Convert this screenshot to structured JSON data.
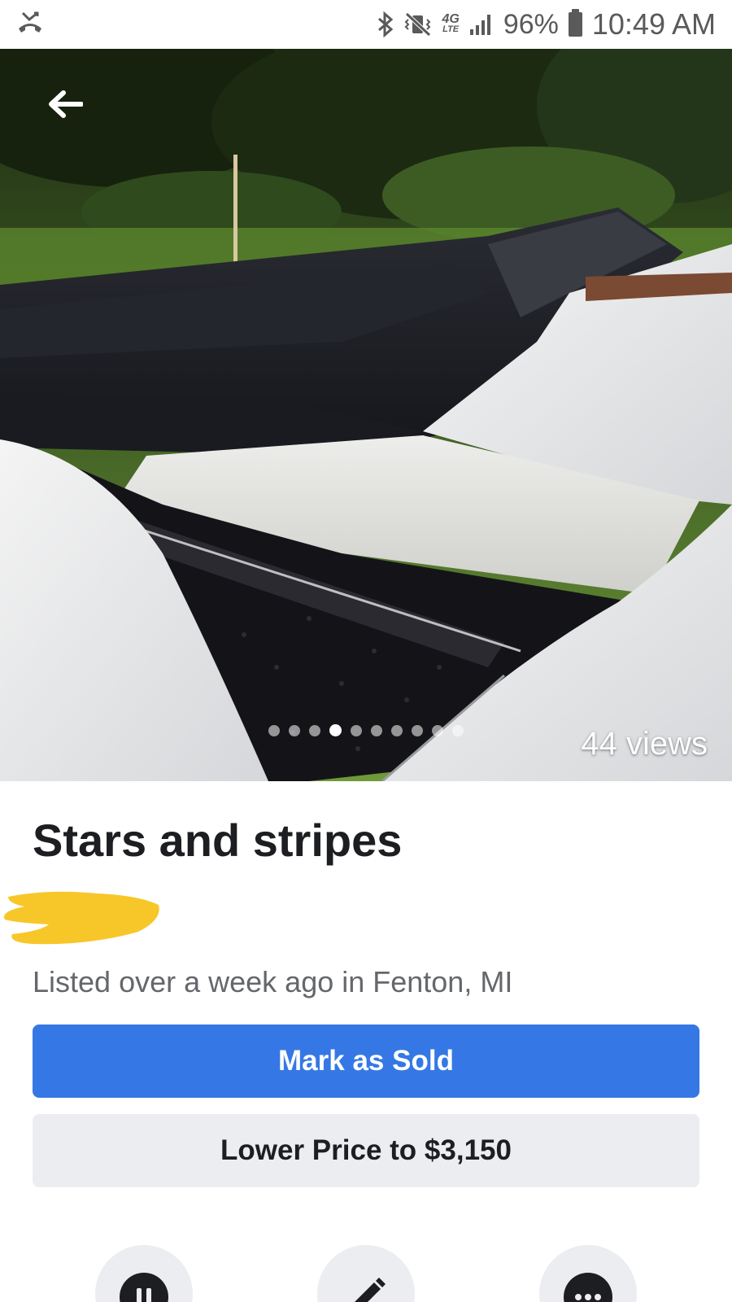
{
  "status_bar": {
    "battery_percent": "96%",
    "time": "10:49 AM",
    "network_label": "4G",
    "network_sub": "LTE",
    "icons": [
      "missed-call-icon",
      "bluetooth-icon",
      "vibrate-icon",
      "lte-icon",
      "signal-icon",
      "battery-icon"
    ]
  },
  "hero": {
    "views_text": "44 views",
    "photo_count": 10,
    "active_photo_index": 3,
    "back_icon": "arrow-left-icon"
  },
  "listing": {
    "title": "Stars and stripes",
    "listed_text": "Listed over a week ago in Fenton, MI"
  },
  "actions": {
    "mark_sold_label": "Mark as Sold",
    "lower_price_label": "Lower Price to $3,150",
    "bottom_icons": [
      "pause-icon",
      "edit-pencil-icon",
      "more-dots-icon"
    ]
  },
  "colors": {
    "primary_button": "#3578e5",
    "secondary_button": "#ebedf0",
    "redaction": "#f7c72a"
  }
}
